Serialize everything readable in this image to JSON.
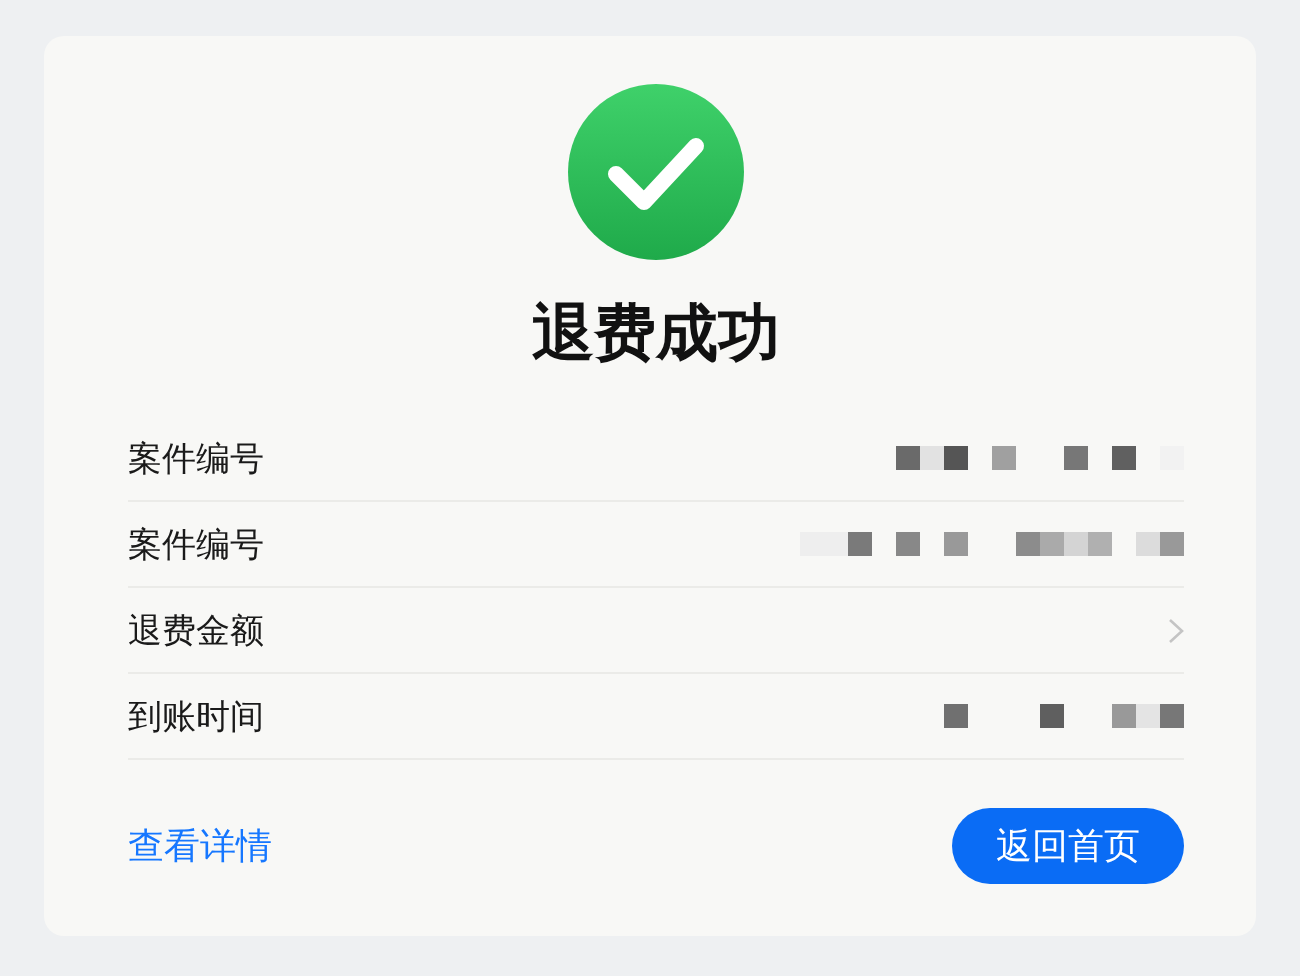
{
  "title": "退费成功",
  "rows": [
    {
      "label": "案件编号",
      "kind": "masked"
    },
    {
      "label": "案件编号",
      "kind": "masked"
    },
    {
      "label": "退费金额",
      "kind": "link"
    },
    {
      "label": "到账时间",
      "kind": "masked"
    }
  ],
  "footer": {
    "link": "查看详情",
    "button": "返回首页"
  }
}
